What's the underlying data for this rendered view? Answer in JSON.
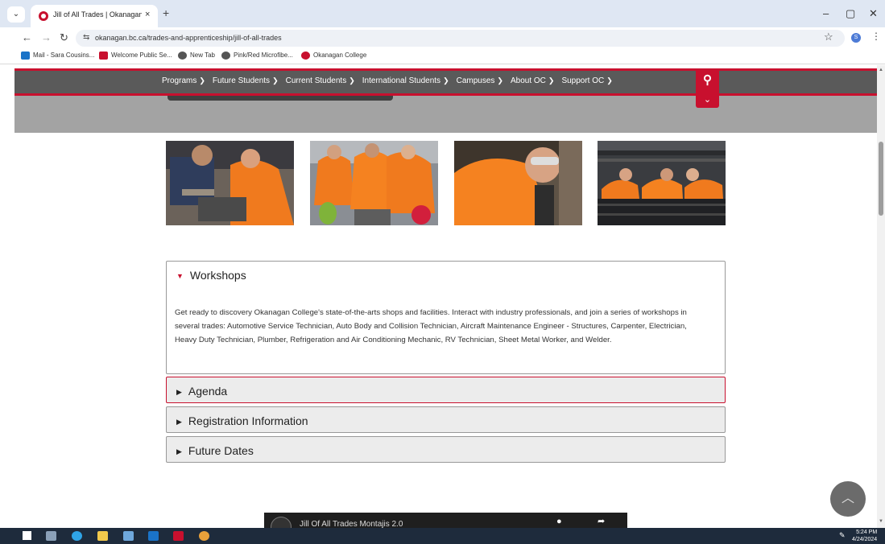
{
  "browser": {
    "tab_title": "Jill of All Trades | Okanagan Co",
    "new_tab_symbol": "+",
    "tab_close_symbol": "×",
    "url": "okanagan.bc.ca/trades-and-apprenticeship/jill-of-all-trades",
    "window_controls": [
      "–",
      "▢",
      "✕"
    ],
    "bookmarks": [
      {
        "label": "Mail - Sara Cousins...",
        "color": "#1a73c8"
      },
      {
        "label": "Welcome Public Se...",
        "color": "#c8102e"
      },
      {
        "label": "New Tab",
        "color": "#555555"
      },
      {
        "label": "Pink/Red Microfibe...",
        "color": "#555555"
      },
      {
        "label": "Okanagan College",
        "color": "#c8102e"
      }
    ],
    "profile_initial": "S"
  },
  "site": {
    "nav": [
      {
        "label": "Programs"
      },
      {
        "label": "Future Students"
      },
      {
        "label": "Current Students"
      },
      {
        "label": "International Students"
      },
      {
        "label": "Campuses"
      },
      {
        "label": "About OC"
      },
      {
        "label": "Support OC"
      }
    ],
    "accent_color": "#c8102e",
    "accordion": {
      "workshops_title": "Workshops",
      "workshops_body": "Get ready to discovery Okanagan College's state-of-the-arts shops and facilities. Interact with industry professionals, and join a series of workshops in several trades: Automotive Service Technician, Auto Body and Collision Technician, Aircraft Maintenance Engineer - Structures, Carpenter, Electrician,  Heavy Duty Technician, Plumber, Refrigeration and Air Conditioning Mechanic, RV Technician, Sheet Metal Worker, and Welder.",
      "agenda_title": "Agenda",
      "registration_title": "Registration Information",
      "future_title": "Future Dates"
    },
    "video_title": "Jill Of All Trades Montajis 2.0"
  },
  "taskbar": {
    "time": "5:24 PM",
    "date": "4/24/2024"
  }
}
